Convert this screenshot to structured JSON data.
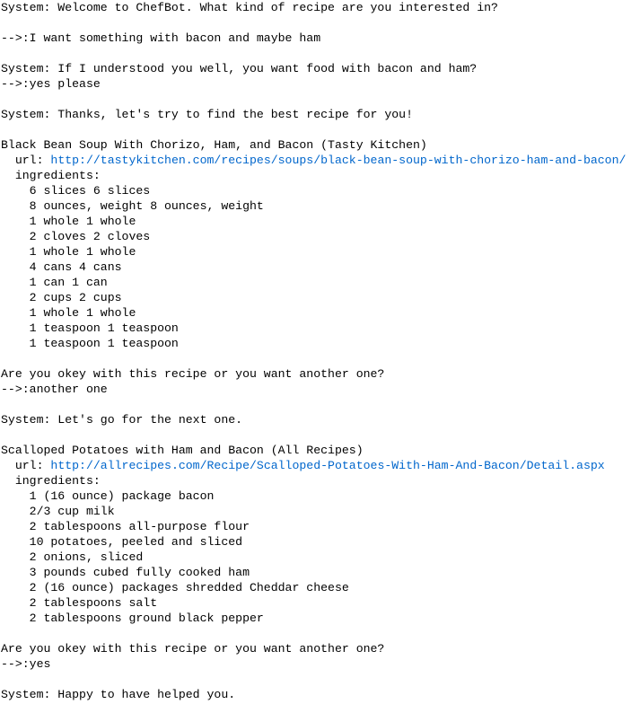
{
  "colors": {
    "background": "#ffffff",
    "text": "#000000",
    "link": "#0066cc"
  },
  "transcript": [
    {
      "text": "System: Welcome to ChefBot. What kind of recipe are you interested in?",
      "kind": "system"
    },
    {
      "text": "",
      "kind": "blank"
    },
    {
      "text": "-->:I want something with bacon and maybe ham",
      "kind": "user"
    },
    {
      "text": "",
      "kind": "blank"
    },
    {
      "text": "System: If I understood you well, you want food with bacon and ham?",
      "kind": "system"
    },
    {
      "text": "-->:yes please",
      "kind": "user"
    },
    {
      "text": "",
      "kind": "blank"
    },
    {
      "text": "System: Thanks, let's try to find the best recipe for you!",
      "kind": "system"
    },
    {
      "text": "",
      "kind": "blank"
    },
    {
      "text": "Black Bean Soup With Chorizo, Ham, and Bacon (Tasty Kitchen)",
      "kind": "recipe-title"
    },
    {
      "text": "  url: ",
      "link": "http://tastykitchen.com/recipes/soups/black-bean-soup-with-chorizo-ham-and-bacon/",
      "kind": "url"
    },
    {
      "text": "  ingredients:",
      "kind": "ingredients-label"
    },
    {
      "text": "    6 slices 6 slices",
      "kind": "ingredient"
    },
    {
      "text": "    8 ounces, weight 8 ounces, weight",
      "kind": "ingredient"
    },
    {
      "text": "    1 whole 1 whole",
      "kind": "ingredient"
    },
    {
      "text": "    2 cloves 2 cloves",
      "kind": "ingredient"
    },
    {
      "text": "    1 whole 1 whole",
      "kind": "ingredient"
    },
    {
      "text": "    4 cans 4 cans",
      "kind": "ingredient"
    },
    {
      "text": "    1 can 1 can",
      "kind": "ingredient"
    },
    {
      "text": "    2 cups 2 cups",
      "kind": "ingredient"
    },
    {
      "text": "    1 whole 1 whole",
      "kind": "ingredient"
    },
    {
      "text": "    1 teaspoon 1 teaspoon",
      "kind": "ingredient"
    },
    {
      "text": "    1 teaspoon 1 teaspoon",
      "kind": "ingredient"
    },
    {
      "text": "",
      "kind": "blank"
    },
    {
      "text": "Are you okey with this recipe or you want another one?",
      "kind": "system"
    },
    {
      "text": "-->:another one",
      "kind": "user"
    },
    {
      "text": "",
      "kind": "blank"
    },
    {
      "text": "System: Let's go for the next one.",
      "kind": "system"
    },
    {
      "text": "",
      "kind": "blank"
    },
    {
      "text": "Scalloped Potatoes with Ham and Bacon (All Recipes)",
      "kind": "recipe-title"
    },
    {
      "text": "  url: ",
      "link": "http://allrecipes.com/Recipe/Scalloped-Potatoes-With-Ham-And-Bacon/Detail.aspx",
      "kind": "url"
    },
    {
      "text": "  ingredients:",
      "kind": "ingredients-label"
    },
    {
      "text": "    1 (16 ounce) package bacon",
      "kind": "ingredient"
    },
    {
      "text": "    2/3 cup milk",
      "kind": "ingredient"
    },
    {
      "text": "    2 tablespoons all-purpose flour",
      "kind": "ingredient"
    },
    {
      "text": "    10 potatoes, peeled and sliced",
      "kind": "ingredient"
    },
    {
      "text": "    2 onions, sliced",
      "kind": "ingredient"
    },
    {
      "text": "    3 pounds cubed fully cooked ham",
      "kind": "ingredient"
    },
    {
      "text": "    2 (16 ounce) packages shredded Cheddar cheese",
      "kind": "ingredient"
    },
    {
      "text": "    2 tablespoons salt",
      "kind": "ingredient"
    },
    {
      "text": "    2 tablespoons ground black pepper",
      "kind": "ingredient"
    },
    {
      "text": "",
      "kind": "blank"
    },
    {
      "text": "Are you okey with this recipe or you want another one?",
      "kind": "system"
    },
    {
      "text": "-->:yes",
      "kind": "user"
    },
    {
      "text": "",
      "kind": "blank"
    },
    {
      "text": "System: Happy to have helped you.",
      "kind": "system"
    }
  ]
}
